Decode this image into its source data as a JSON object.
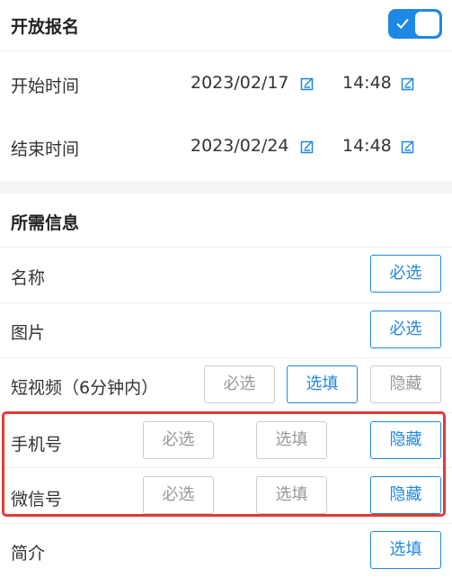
{
  "registration": {
    "title": "开放报名",
    "toggle_on": true,
    "start": {
      "label": "开始时间",
      "date": "2023/02/17",
      "time": "14:48"
    },
    "end": {
      "label": "结束时间",
      "date": "2023/02/24",
      "time": "14:48"
    }
  },
  "required_info": {
    "title": "所需信息",
    "options": {
      "required": "必选",
      "optional": "选填",
      "hidden": "隐藏"
    },
    "rows": [
      {
        "label": "名称",
        "selected": "required"
      },
      {
        "label": "图片",
        "selected": "required"
      },
      {
        "label": "短视频（6分钟内）",
        "selected": "optional"
      },
      {
        "label": "手机号",
        "selected": "hidden"
      },
      {
        "label": "微信号",
        "selected": "hidden"
      },
      {
        "label": "简介",
        "selected": "optional"
      }
    ]
  },
  "colors": {
    "accent": "#1e88e5",
    "highlight_border": "#e53935",
    "inactive_text": "#999999"
  }
}
